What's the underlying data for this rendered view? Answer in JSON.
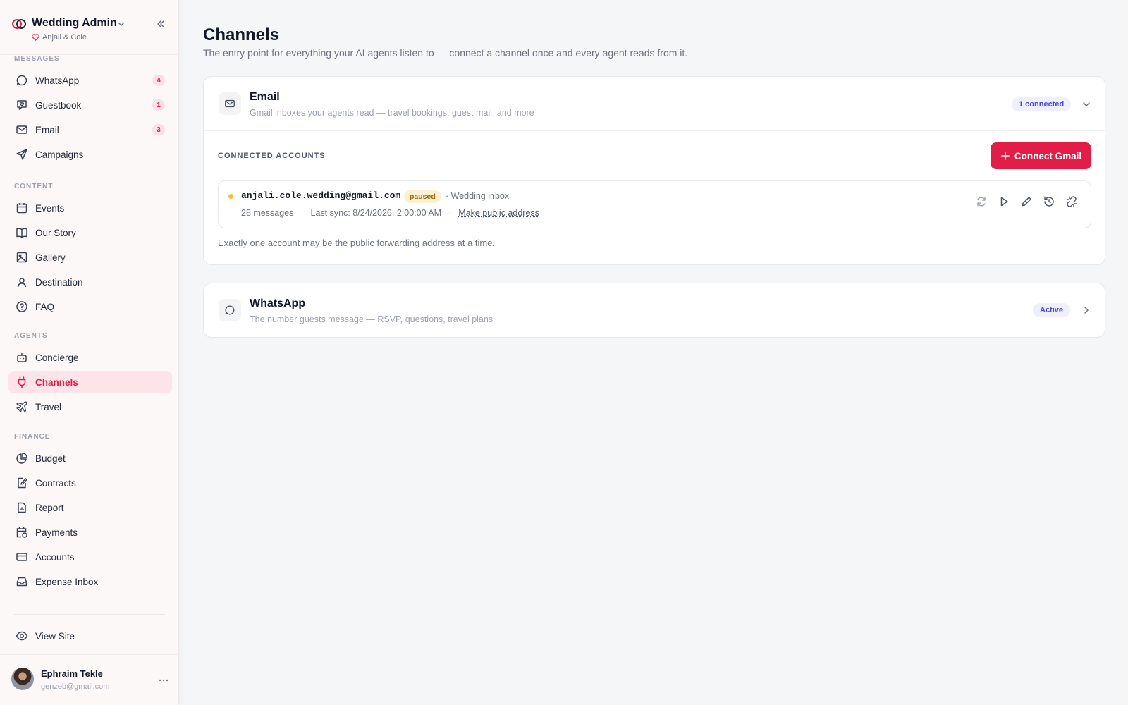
{
  "app": {
    "title": "Wedding Admin",
    "subtitle": "Anjali & Cole"
  },
  "sidebar": {
    "sections": {
      "messages": "MESSAGES",
      "content": "CONTENT",
      "agents": "AGENTS",
      "finance": "FINANCE"
    },
    "items": [
      {
        "label": "WhatsApp",
        "icon": "chat-bubble-icon",
        "badge": "4"
      },
      {
        "label": "Guestbook",
        "icon": "heart-message-icon",
        "badge": "1"
      },
      {
        "label": "Email",
        "icon": "mail-icon",
        "badge": "3"
      },
      {
        "label": "Campaigns",
        "icon": "send-icon"
      },
      {
        "label": "Events",
        "icon": "calendar-icon"
      },
      {
        "label": "Our Story",
        "icon": "book-icon"
      },
      {
        "label": "Gallery",
        "icon": "image-icon"
      },
      {
        "label": "Destination",
        "icon": "location-icon"
      },
      {
        "label": "FAQ",
        "icon": "help-icon"
      },
      {
        "label": "Concierge",
        "icon": "bot-icon"
      },
      {
        "label": "Channels",
        "icon": "plug-icon",
        "active": true
      },
      {
        "label": "Travel",
        "icon": "plane-icon"
      },
      {
        "label": "Budget",
        "icon": "pie-icon"
      },
      {
        "label": "Contracts",
        "icon": "contract-icon"
      },
      {
        "label": "Report",
        "icon": "report-icon"
      },
      {
        "label": "Payments",
        "icon": "payment-calendar-icon"
      },
      {
        "label": "Accounts",
        "icon": "card-icon"
      },
      {
        "label": "Expense Inbox",
        "icon": "inbox-icon"
      }
    ],
    "view_site": "View Site",
    "user": {
      "name": "Ephraim Tekle",
      "email": "genzeb@gmail.com"
    }
  },
  "page": {
    "title": "Channels",
    "subtitle": "The entry point for everything your AI agents listen to — connect a channel once and every agent reads from it."
  },
  "email_card": {
    "title": "Email",
    "description": "Gmail inboxes your agents read — travel bookings, guest mail, and more",
    "status": "1 connected",
    "accounts_label": "CONNECTED ACCOUNTS",
    "connect_button": "Connect Gmail",
    "account": {
      "email": "anjali.cole.wedding@gmail.com",
      "status": "paused",
      "inbox": "· Wedding inbox",
      "messages": "28 messages",
      "last_sync": "Last sync: 8/24/2026, 2:00:00 AM",
      "make_public": "Make public address"
    },
    "note": "Exactly one account may be the public forwarding address at a time."
  },
  "whatsapp_card": {
    "title": "WhatsApp",
    "description": "The number guests message — RSVP, questions, travel plans",
    "status": "Active"
  },
  "colors": {
    "accent": "#e11d48",
    "paused_dot": "#fbbf24",
    "indigo": "#4f46e5"
  }
}
